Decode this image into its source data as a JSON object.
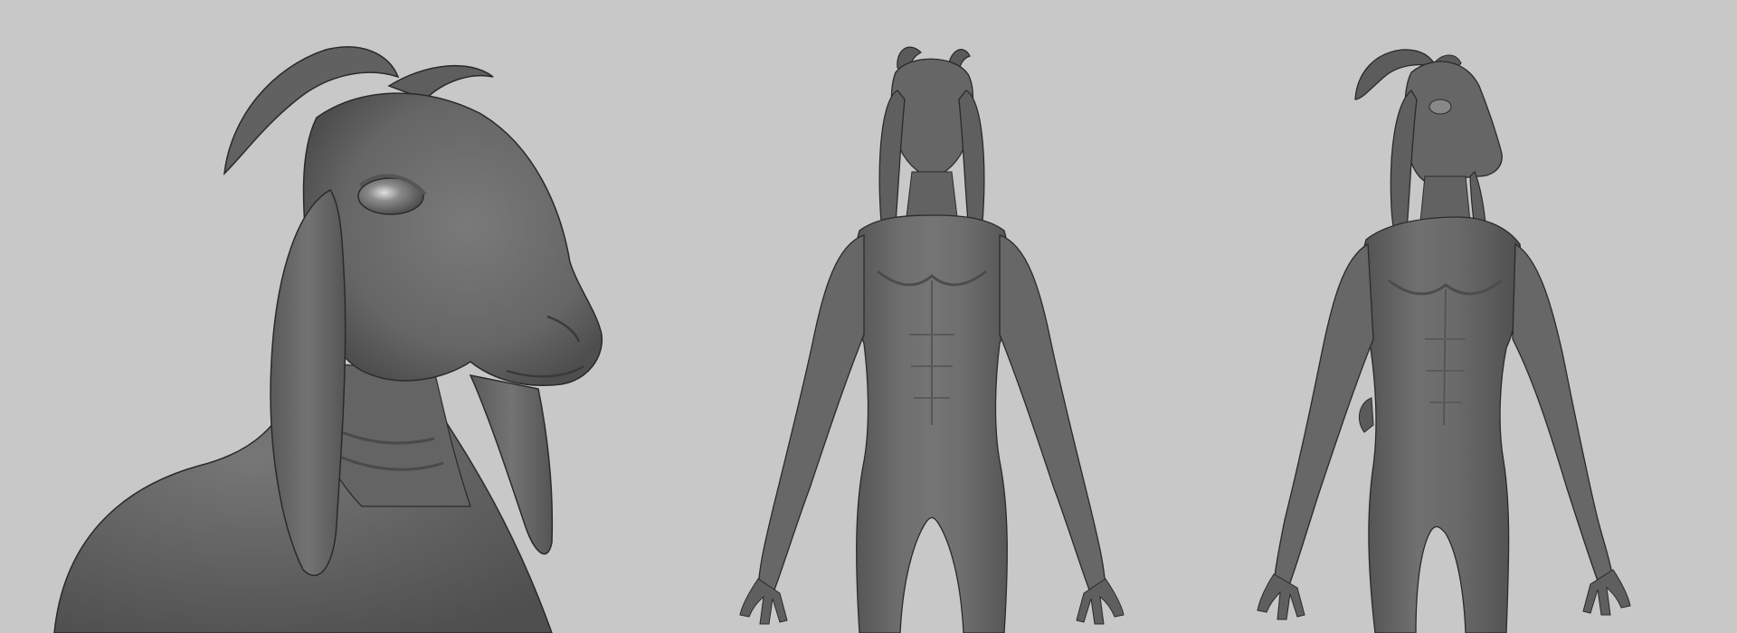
{
  "scene": {
    "background_color": "#c8c8c8",
    "model_color": "#6d6d6d",
    "shadow_color": "#4a4a4a",
    "highlight_color": "#8a8a8a",
    "outline_color": "#2a2a2a",
    "views": [
      {
        "id": "closeup",
        "subject": "goat-creature-head-closeup"
      },
      {
        "id": "front",
        "subject": "goat-creature-full-body-front"
      },
      {
        "id": "three-quarter",
        "subject": "goat-creature-full-body-three-quarter"
      }
    ]
  }
}
